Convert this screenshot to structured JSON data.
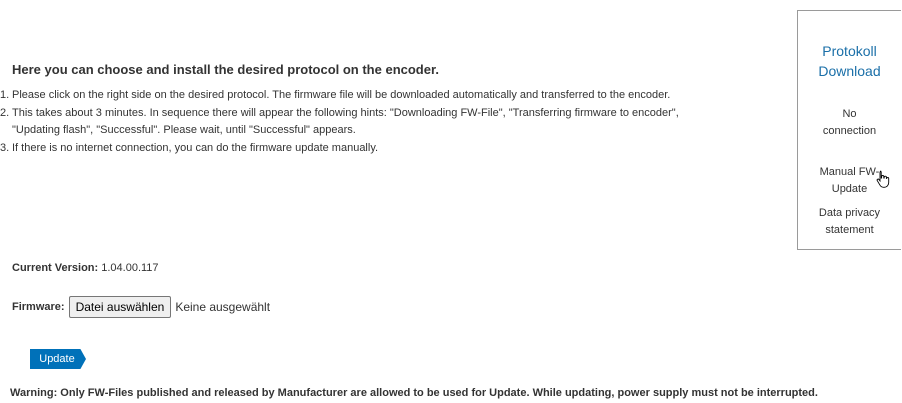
{
  "main": {
    "heading": "Here you can choose and install the desired protocol on the encoder.",
    "steps": [
      {
        "num": "1.",
        "text": "Please click on the right side on the desired protocol. The firmware file will be downloaded automatically and transferred to the encoder."
      },
      {
        "num": "2.",
        "text": "This takes about 3 minutes. In sequence there will appear the following hints: \"Downloading FW-File\", \"Transferring firmware to encoder\",",
        "text2": "\"Updating flash\", \"Successful\". Please wait, until \"Successful\" appears."
      },
      {
        "num": "3.",
        "text": "If there is no internet connection, you can do the firmware update manually."
      }
    ],
    "version_label": "Current Version:",
    "version_value": "1.04.00.117",
    "firmware_label": "Firmware:",
    "file_button": "Datei auswählen",
    "file_status": "Keine ausgewählt",
    "update_button": "Update",
    "warning": "Warning: Only FW-Files published and released by Manufacturer are allowed to be used for Update. While updating, power supply must not be interrupted."
  },
  "sidebar": {
    "title": "Protokoll Download",
    "status": "No connection",
    "manual_link": "Manual FW-Update",
    "privacy_link": "Data privacy statement"
  },
  "colors": {
    "accent": "#0071b9",
    "link": "#1a6fa8"
  }
}
